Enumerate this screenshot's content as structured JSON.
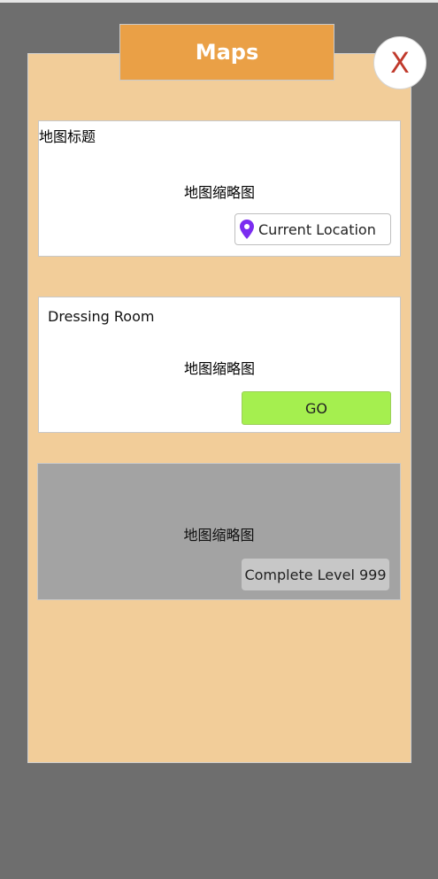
{
  "header": {
    "title": "Maps",
    "close_label": "X"
  },
  "cards": [
    {
      "title": "地图标题",
      "thumbnail_text": "地图缩略图",
      "action_label": "Current Location",
      "action_type": "current"
    },
    {
      "title": "Dressing Room",
      "thumbnail_text": "地图缩略图",
      "action_label": "GO",
      "action_type": "go"
    },
    {
      "title": "",
      "thumbnail_text": "地图缩略图",
      "action_label": "Complete Level 999",
      "action_type": "locked"
    }
  ],
  "colors": {
    "backdrop": "#6e6e6e",
    "panel": "#f2cd99",
    "title_tab": "#eaa046",
    "close_x": "#c0392b",
    "go_button": "#a5ef4f",
    "locked_card": "#a3a3a3",
    "pin_icon": "#7b2cf0"
  },
  "icons": {
    "location": "map-pin-icon"
  }
}
